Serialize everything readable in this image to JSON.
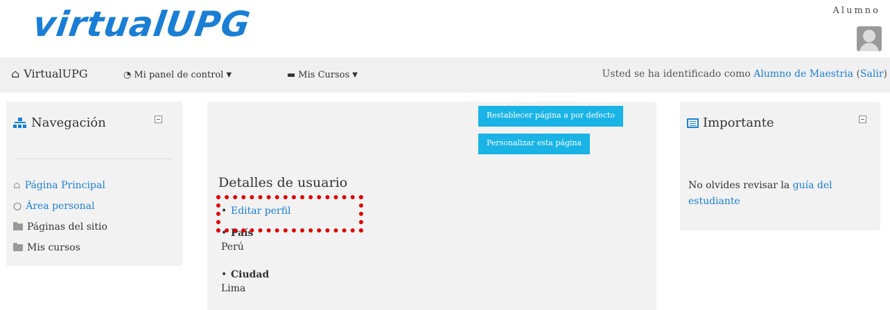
{
  "header": {
    "logo": "virtualUPG",
    "user_name": "Alumno"
  },
  "navbar": {
    "brand": "VirtualUPG",
    "dashboard_label": "Mi panel de control",
    "courses_label": "Mis Cursos",
    "login_prefix": "Usted se ha identificado como",
    "login_user": "Alumno de Maestria",
    "logout_open": "(",
    "logout_label": "Salir",
    "logout_close": ")"
  },
  "navigation_block": {
    "title": "Navegación",
    "items": [
      {
        "label": "Página Principal",
        "icon": "home-icon"
      },
      {
        "label": "Área personal",
        "icon": "circle-icon"
      },
      {
        "label": "Páginas del sitio",
        "icon": "folder-icon"
      },
      {
        "label": "Mis cursos",
        "icon": "folder-icon"
      }
    ]
  },
  "main": {
    "reset_button": "Restablecer página a por defecto",
    "customize_button": "Personalizar esta página",
    "section_title": "Detalles de usuario",
    "edit_profile": "Editar perfil",
    "country_label": "País",
    "country_value": "Perú",
    "city_label": "Ciudad",
    "city_value": "Lima"
  },
  "important_block": {
    "title": "Importante",
    "text_prefix": "No olvides revisar la",
    "link": "guía del estudiante"
  },
  "colors": {
    "link": "#1a7fd4",
    "button": "#1ab3e6",
    "highlight": "#e00000"
  }
}
